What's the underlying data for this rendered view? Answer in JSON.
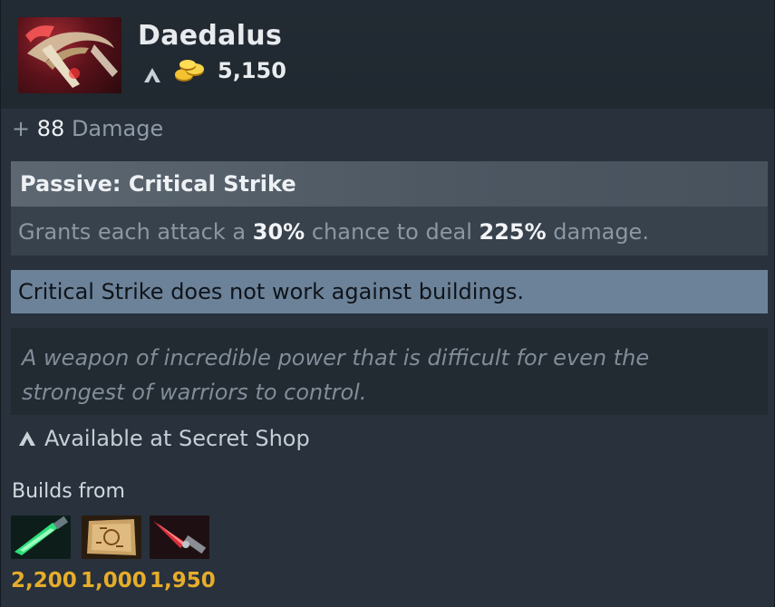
{
  "item": {
    "name": "Daedalus",
    "icon": "daedalus-item-icon",
    "cost": "5,150"
  },
  "stats": {
    "damage_prefix": "+",
    "damage_value": "88",
    "damage_label": "Damage"
  },
  "passive": {
    "title": "Passive: Critical Strike",
    "desc_pre": "Grants each attack a",
    "chance": "30%",
    "desc_mid": "chance to deal",
    "multiplier": "225%",
    "desc_post": "damage."
  },
  "note": "Critical Strike does not work against buildings.",
  "lore": "A weapon of incredible power that is difficult for even the strongest of warriors to control.",
  "shop": "Available at Secret Shop",
  "builds": {
    "label": "Builds from",
    "components": [
      {
        "icon": "green-blade-icon",
        "price": "2,200"
      },
      {
        "icon": "recipe-scroll-icon",
        "price": "1,000"
      },
      {
        "icon": "red-blade-icon",
        "price": "1,950"
      }
    ]
  },
  "colors": {
    "price_gold": "#e6ad2a",
    "note_bg": "#6c8299",
    "card_bg": "#28313c"
  }
}
